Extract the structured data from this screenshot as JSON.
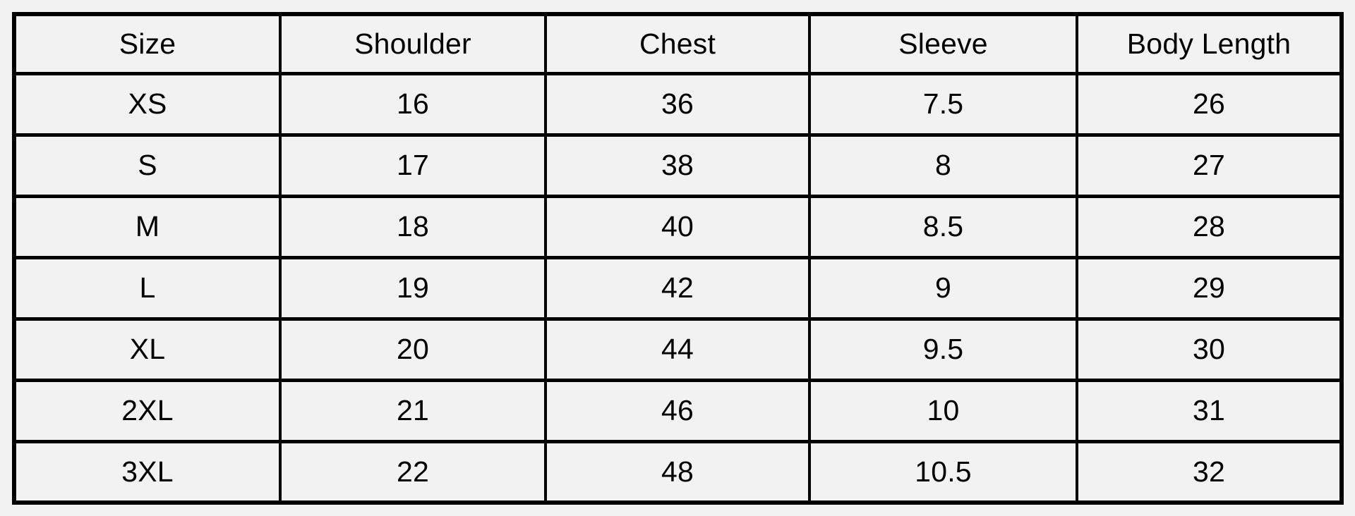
{
  "document": {
    "kind": "size-chart-table",
    "background_color": "#f2f2f2",
    "cell_background_color": "#f2f2f2",
    "border_color": "#000000",
    "text_color": "#000000"
  },
  "table": {
    "columns": [
      "Size",
      "Shoulder",
      "Chest",
      "Sleeve",
      "Body Length"
    ],
    "rows": [
      {
        "size": "XS",
        "shoulder": "16",
        "chest": "36",
        "sleeve": "7.5",
        "body_length": "26"
      },
      {
        "size": "S",
        "shoulder": "17",
        "chest": "38",
        "sleeve": "8",
        "body_length": "27"
      },
      {
        "size": "M",
        "shoulder": "18",
        "chest": "40",
        "sleeve": "8.5",
        "body_length": "28"
      },
      {
        "size": "L",
        "shoulder": "19",
        "chest": "42",
        "sleeve": "9",
        "body_length": "29"
      },
      {
        "size": "XL",
        "shoulder": "20",
        "chest": "44",
        "sleeve": "9.5",
        "body_length": "30"
      },
      {
        "size": "2XL",
        "shoulder": "21",
        "chest": "46",
        "sleeve": "10",
        "body_length": "31"
      },
      {
        "size": "3XL",
        "shoulder": "22",
        "chest": "48",
        "sleeve": "10.5",
        "body_length": "32"
      }
    ]
  },
  "chart_data": {
    "type": "table",
    "title": "",
    "columns": [
      "Size",
      "Shoulder",
      "Chest",
      "Sleeve",
      "Body Length"
    ],
    "categories": [
      "XS",
      "S",
      "M",
      "L",
      "XL",
      "2XL",
      "3XL"
    ],
    "series": [
      {
        "name": "Shoulder",
        "values": [
          16,
          17,
          18,
          19,
          20,
          21,
          22
        ]
      },
      {
        "name": "Chest",
        "values": [
          36,
          38,
          40,
          42,
          44,
          46,
          48
        ]
      },
      {
        "name": "Sleeve",
        "values": [
          7.5,
          8,
          8.5,
          9,
          9.5,
          10,
          10.5
        ]
      },
      {
        "name": "Body Length",
        "values": [
          26,
          27,
          28,
          29,
          30,
          31,
          32
        ]
      }
    ]
  }
}
